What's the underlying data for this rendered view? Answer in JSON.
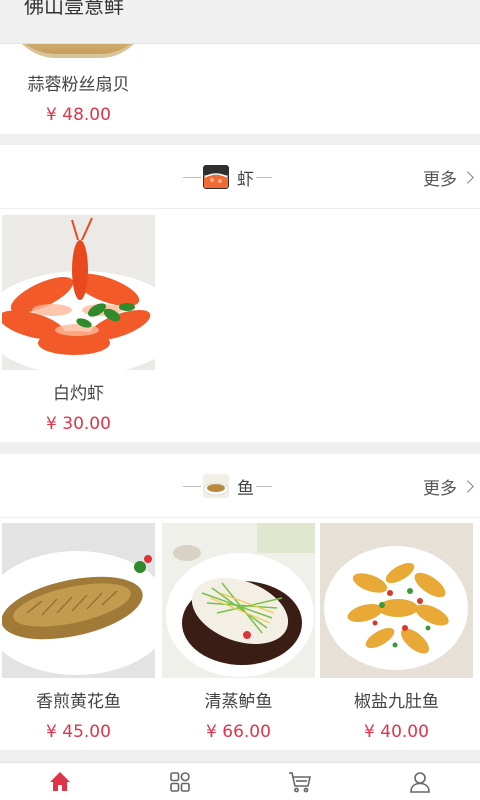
{
  "header": {
    "title": "佛山壹意鲜"
  },
  "top_section": {
    "item_name": "蒜蓉粉丝扇贝",
    "item_price": "¥ 48.00"
  },
  "categories": [
    {
      "label": "虾",
      "more_label": "更多",
      "items": [
        {
          "name": "白灼虾",
          "price": "¥ 30.00"
        }
      ]
    },
    {
      "label": "鱼",
      "more_label": "更多",
      "items": [
        {
          "name": "香煎黄花鱼",
          "price": "¥ 45.00"
        },
        {
          "name": "清蒸鲈鱼",
          "price": "¥ 66.00"
        },
        {
          "name": "椒盐九肚鱼",
          "price": "¥ 40.00"
        }
      ]
    }
  ],
  "bottom_nav": [
    {
      "icon": "home-icon",
      "active": true
    },
    {
      "icon": "category-icon",
      "active": false
    },
    {
      "icon": "cart-icon",
      "active": false
    },
    {
      "icon": "user-icon",
      "active": false
    }
  ],
  "colors": {
    "price": "#e0344b",
    "accent": "#e0344b",
    "nav_inactive": "#666666"
  }
}
